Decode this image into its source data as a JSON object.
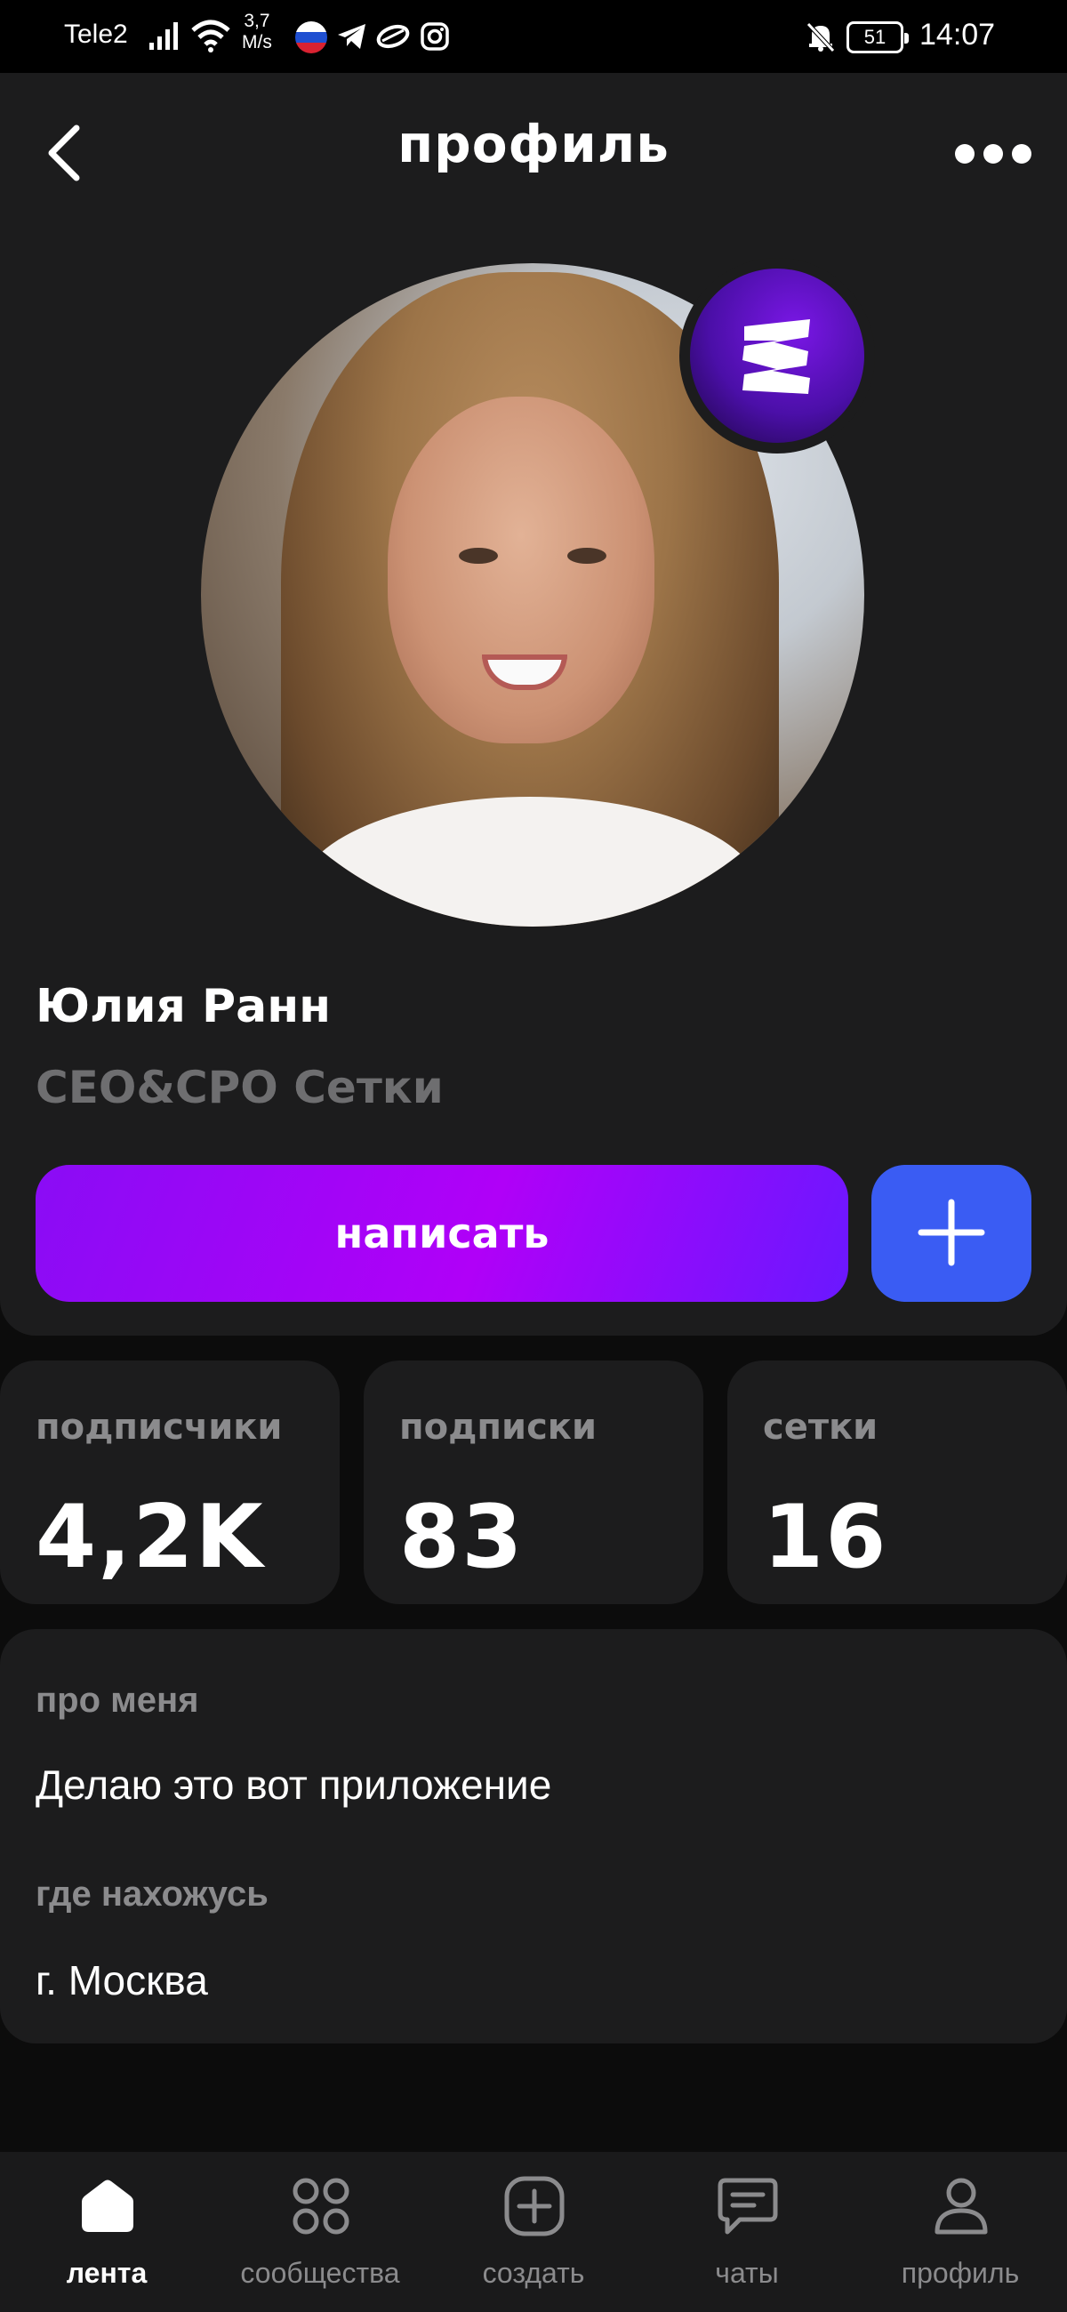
{
  "status_bar": {
    "carrier": "Tele2",
    "speed_value": "3,7",
    "speed_unit": "M/s",
    "battery": "51",
    "time": "14:07"
  },
  "header": {
    "title": "профиль"
  },
  "profile": {
    "name": "Юлия Ранн",
    "role": "CEO&CPO Сетки",
    "write_label": "написать"
  },
  "stats": [
    {
      "label": "подписчики",
      "value": "4,2K"
    },
    {
      "label": "подписки",
      "value": "83"
    },
    {
      "label": "сетки",
      "value": "16"
    }
  ],
  "about": {
    "about_label": "про меня",
    "about_text": "Делаю это вот приложение",
    "location_label": "где нахожусь",
    "location_text": "г. Москва"
  },
  "tabs": [
    {
      "label": "лента",
      "icon": "home-icon",
      "active": true
    },
    {
      "label": "сообщества",
      "icon": "grid-icon",
      "active": false
    },
    {
      "label": "создать",
      "icon": "add-square-icon",
      "active": false
    },
    {
      "label": "чаты",
      "icon": "chat-icon",
      "active": false
    },
    {
      "label": "профиль",
      "icon": "person-icon",
      "active": false
    }
  ],
  "colors": {
    "background": "#0c0c0c",
    "card": "#1c1c1d",
    "accent_purple": "#b000f8",
    "accent_blue": "#3a5cf3",
    "muted_text": "#8b8b8d"
  }
}
